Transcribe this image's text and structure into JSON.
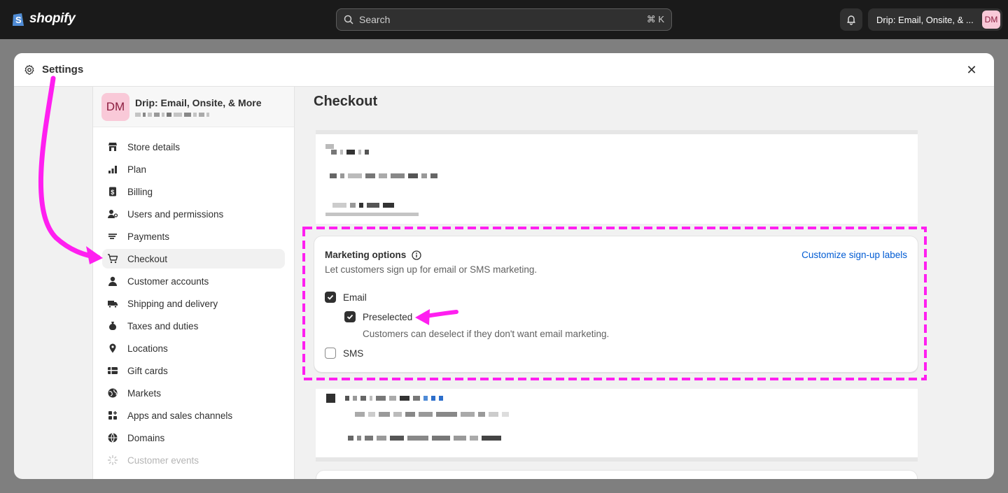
{
  "topbar": {
    "logo_text": "shopify",
    "search_placeholder": "Search",
    "search_shortcut": "⌘ K",
    "store_switcher_name": "Drip: Email, Onsite, & ...",
    "avatar_initials": "DM"
  },
  "modal": {
    "title": "Settings"
  },
  "sidebar": {
    "store_name": "Drip: Email, Onsite, & More",
    "avatar_initials": "DM",
    "items": [
      {
        "label": "Store details",
        "icon": "store-icon"
      },
      {
        "label": "Plan",
        "icon": "plan-icon"
      },
      {
        "label": "Billing",
        "icon": "billing-icon"
      },
      {
        "label": "Users and permissions",
        "icon": "users-icon"
      },
      {
        "label": "Payments",
        "icon": "payments-icon"
      },
      {
        "label": "Checkout",
        "icon": "cart-icon"
      },
      {
        "label": "Customer accounts",
        "icon": "person-icon"
      },
      {
        "label": "Shipping and delivery",
        "icon": "truck-icon"
      },
      {
        "label": "Taxes and duties",
        "icon": "tax-icon"
      },
      {
        "label": "Locations",
        "icon": "location-icon"
      },
      {
        "label": "Gift cards",
        "icon": "gift-card-icon"
      },
      {
        "label": "Markets",
        "icon": "globe-icon"
      },
      {
        "label": "Apps and sales channels",
        "icon": "apps-icon"
      },
      {
        "label": "Domains",
        "icon": "domains-icon"
      },
      {
        "label": "Customer events",
        "icon": "events-icon"
      }
    ],
    "active_item": "Checkout"
  },
  "main": {
    "page_title": "Checkout",
    "marketing": {
      "title": "Marketing options",
      "subtitle": "Let customers sign up for email or SMS marketing.",
      "link": "Customize sign-up labels",
      "email_label": "Email",
      "email_checked": true,
      "preselected_label": "Preselected",
      "preselected_checked": true,
      "preselected_help": "Customers can deselect if they don't want email marketing.",
      "sms_label": "SMS",
      "sms_checked": false
    }
  },
  "colors": {
    "annotation": "#ff1ff0",
    "link": "#005bd3",
    "topbar": "#1a1a1a"
  }
}
